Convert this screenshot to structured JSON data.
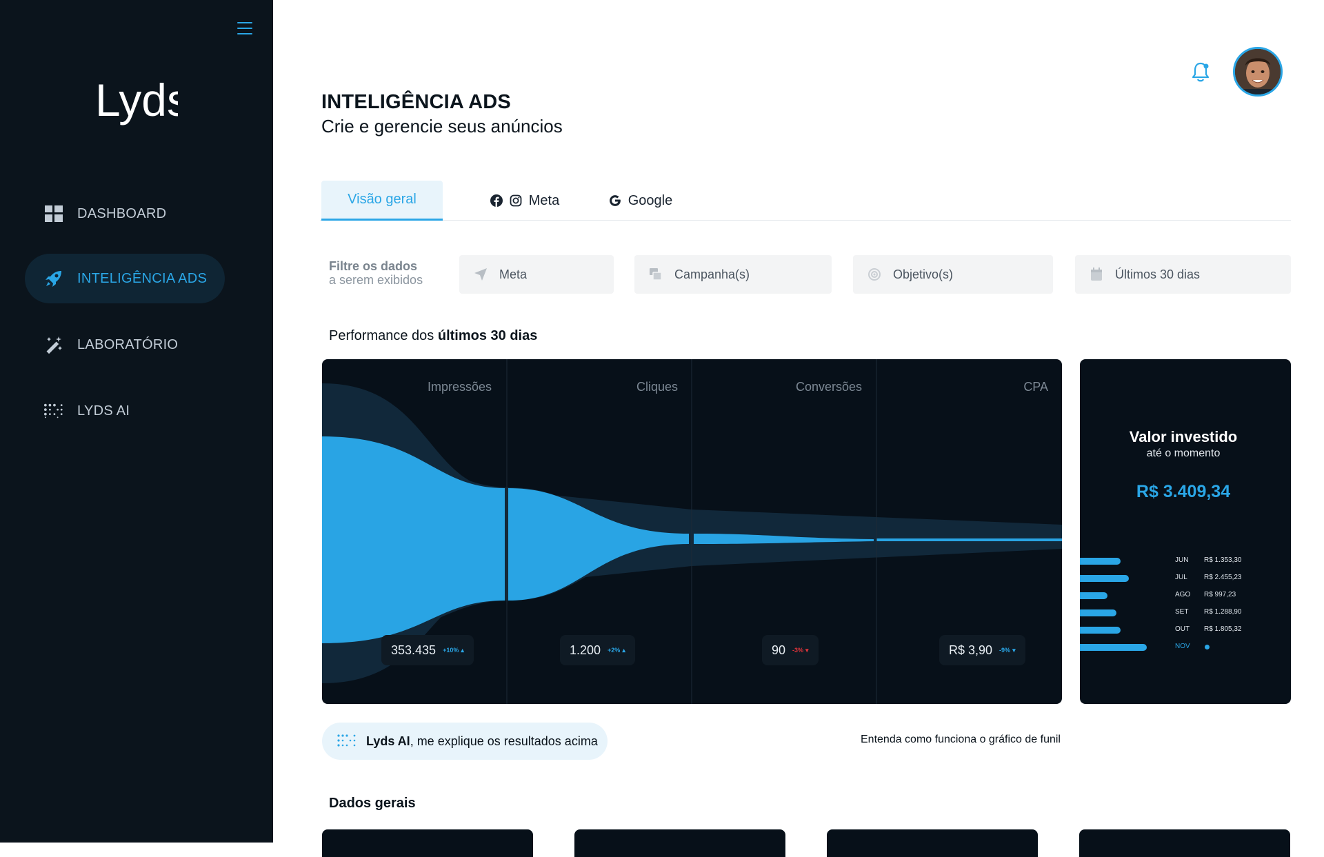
{
  "sidebar": {
    "logo_text": "Lyds",
    "items": [
      {
        "label": "DASHBOARD",
        "icon": "grid-icon"
      },
      {
        "label": "INTELIGÊNCIA ADS",
        "icon": "rocket-icon"
      },
      {
        "label": "LABORATÓRIO",
        "icon": "magic-wand-icon"
      },
      {
        "label": "LYDS AI",
        "icon": "dots-grid-icon"
      }
    ]
  },
  "header": {
    "title": "INTELIGÊNCIA ADS",
    "subtitle": "Crie e gerencie seus anúncios"
  },
  "tabs": [
    {
      "label": "Visão geral"
    },
    {
      "label": "Meta"
    },
    {
      "label": "Google"
    }
  ],
  "filters": {
    "label_line1": "Filtre os dados",
    "label_line2": "a serem exibidos",
    "items": [
      {
        "label": "Meta",
        "icon": "send-icon"
      },
      {
        "label": "Campanha(s)",
        "icon": "layers-icon"
      },
      {
        "label": "Objetivo(s)",
        "icon": "target-icon"
      },
      {
        "label": "Últimos 30 dias",
        "icon": "calendar-icon"
      }
    ]
  },
  "performance": {
    "prefix": "Performance dos ",
    "emphasis": "últimos 30 dias"
  },
  "funnel": {
    "columns": [
      {
        "label": "Impressões",
        "value": "353.435",
        "delta": "+10%",
        "trend": "up"
      },
      {
        "label": "Cliques",
        "value": "1.200",
        "delta": "+2%",
        "trend": "up"
      },
      {
        "label": "Conversões",
        "value": "90",
        "delta": "-3%",
        "trend": "down"
      },
      {
        "label": "CPA",
        "value": "R$ 3,90",
        "delta": "-9%",
        "trend": "up"
      }
    ]
  },
  "investment": {
    "title": "Valor investido",
    "subtitle": "até o momento",
    "total": "R$ 3.409,34",
    "months": [
      {
        "month": "JUN",
        "amount": "R$ 1.353,30",
        "fraction": 0.5
      },
      {
        "month": "JUL",
        "amount": "R$ 2.455,23",
        "fraction": 0.6
      },
      {
        "month": "AGO",
        "amount": "R$ 997,23",
        "fraction": 0.34
      },
      {
        "month": "SET",
        "amount": "R$ 1.288,90",
        "fraction": 0.45
      },
      {
        "month": "OUT",
        "amount": "R$ 1.805,32",
        "fraction": 0.5
      },
      {
        "month": "NOV",
        "amount": "",
        "fraction": 0.82,
        "current": true
      }
    ]
  },
  "ai_prompt": {
    "strong": "Lyds AI",
    "text": ", me explique os resultados acima"
  },
  "funnel_help": "Entenda como funciona o gráfico de funil",
  "general_data": {
    "title": "Dados gerais"
  },
  "colors": {
    "accent": "#2aa6e6",
    "dark": "#0b141c",
    "card": "#071019",
    "negative": "#e0343a"
  }
}
